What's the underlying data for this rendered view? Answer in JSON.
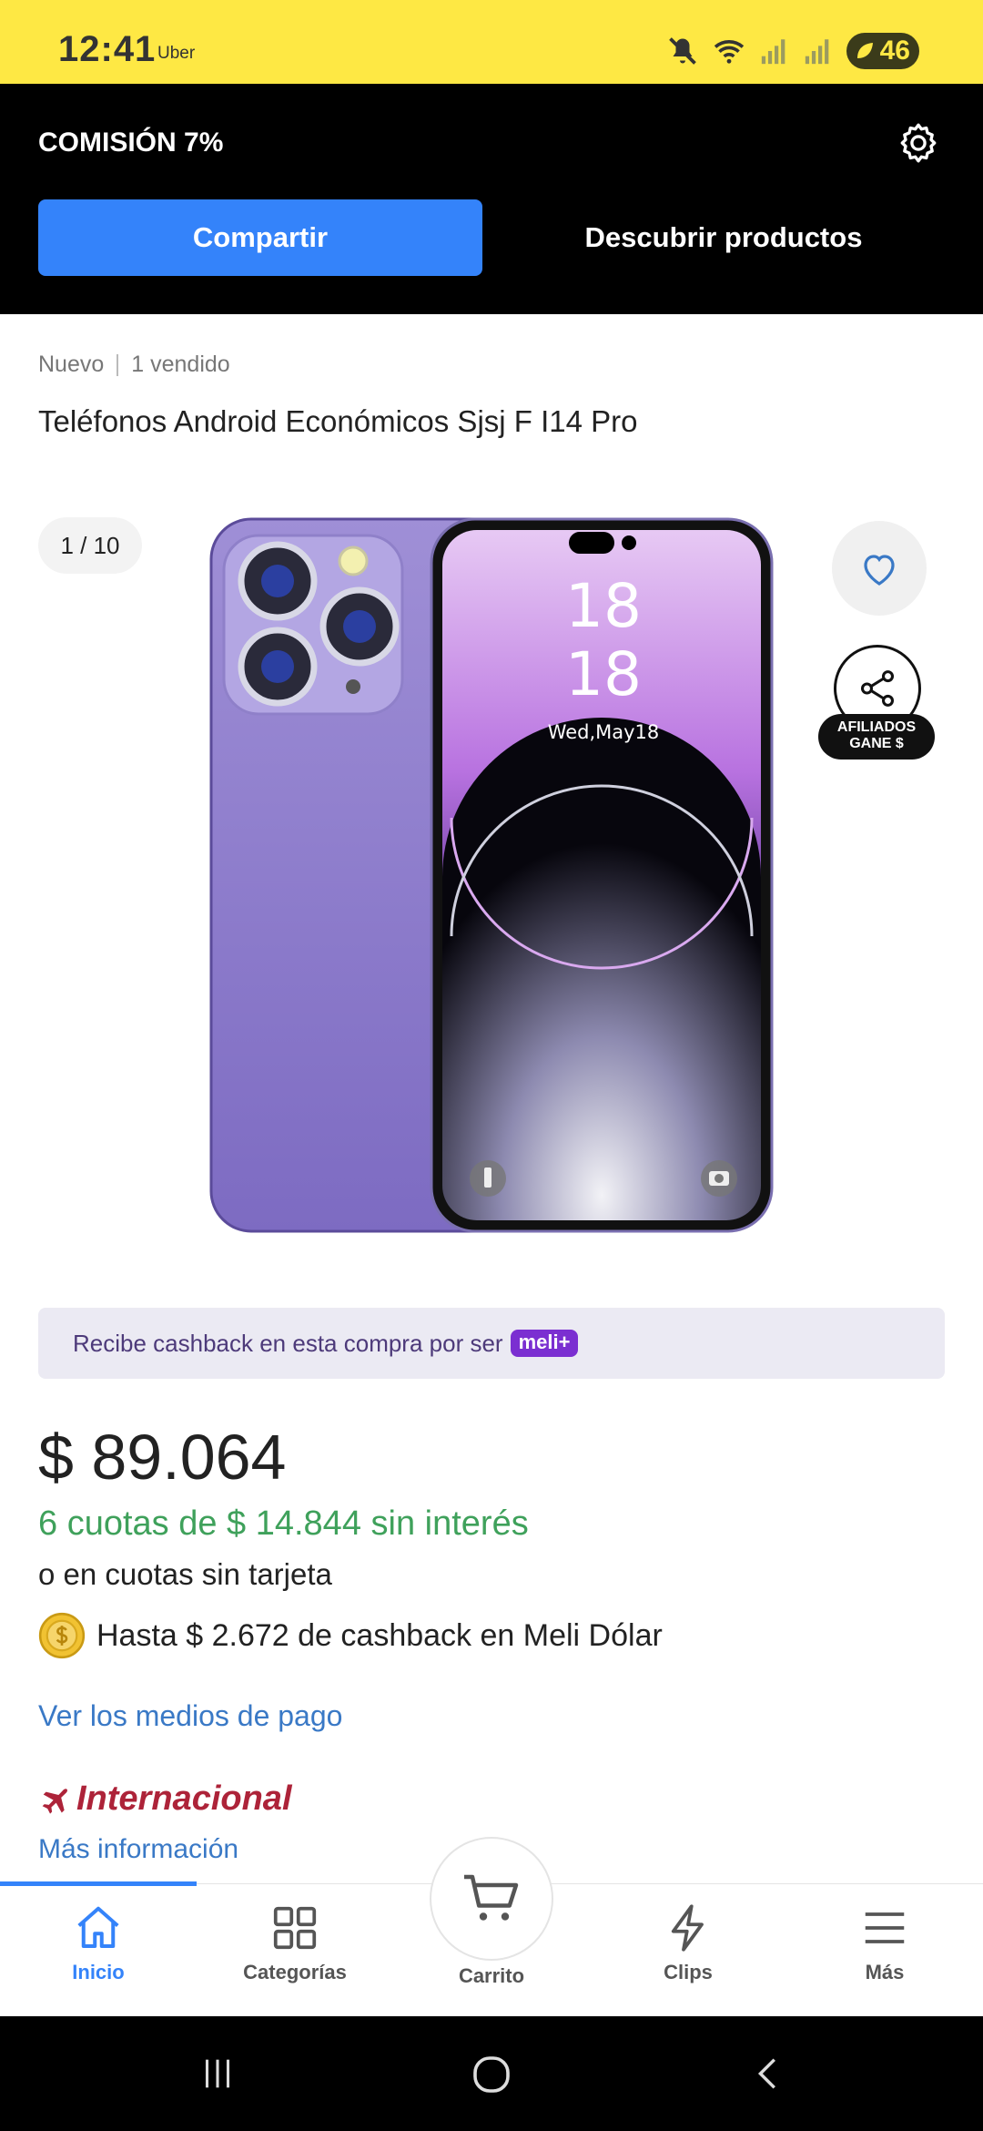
{
  "status_bar": {
    "time": "12:41",
    "app_label": "Uber",
    "battery": "46"
  },
  "affiliate": {
    "commission": "COMISIÓN 7%",
    "share_label": "Compartir",
    "discover_label": "Descubrir productos"
  },
  "product": {
    "condition": "Nuevo",
    "sold": "1 vendido",
    "title": "Teléfonos Android Económicos Sjsj F I14 Pro"
  },
  "gallery": {
    "pager": "1 / 10",
    "phone_time_hours": "18",
    "phone_time_minutes": "18",
    "phone_date": "Wed,May18",
    "affiliate_badge_line1": "AFILIADOS",
    "affiliate_badge_line2": "GANE $"
  },
  "banner": {
    "text": "Recibe cashback en esta compra por ser",
    "badge": "meli+"
  },
  "pricing": {
    "price": "$ 89.064",
    "installments": "6 cuotas de $ 14.844 sin interés",
    "no_card": "o en cuotas sin tarjeta",
    "cashback": "Hasta $ 2.672 de cashback en Meli Dólar",
    "payment_link": "Ver los medios de pago"
  },
  "shipping": {
    "label": "Internacional",
    "more_info": "Más información"
  },
  "bottom_nav": {
    "items": [
      {
        "label": "Inicio",
        "icon": "home-icon",
        "active": true
      },
      {
        "label": "Categorías",
        "icon": "grid-icon"
      },
      {
        "label": "Carrito",
        "icon": "cart-icon"
      },
      {
        "label": "Clips",
        "icon": "lightning-icon"
      },
      {
        "label": "Más",
        "icon": "menu-icon"
      }
    ]
  },
  "colors": {
    "status_bar": "#fee844",
    "primary": "#3483fa",
    "green": "#3fa15b",
    "link": "#3a79c6",
    "international": "#ad2339",
    "meli_badge": "#7b2fd1"
  }
}
